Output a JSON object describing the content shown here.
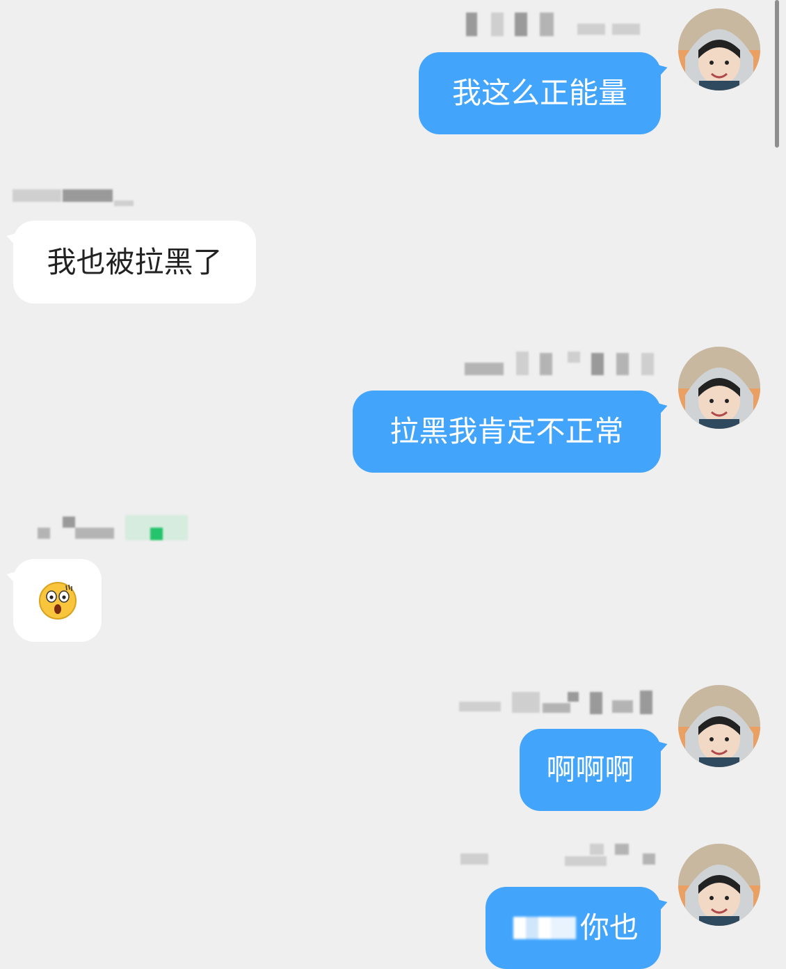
{
  "messages": [
    {
      "side": "out",
      "text": "我这么正能量"
    },
    {
      "side": "in",
      "text": "我也被拉黑了"
    },
    {
      "side": "out",
      "text": "拉黑我肯定不正常"
    },
    {
      "side": "in",
      "emoji": "surprised-face-icon"
    },
    {
      "side": "out",
      "text": "啊啊啊"
    },
    {
      "side": "out",
      "text": "你也"
    }
  ],
  "colors": {
    "background": "#efefef",
    "outgoing_bubble": "#42a5fb",
    "incoming_bubble": "#ffffff"
  }
}
